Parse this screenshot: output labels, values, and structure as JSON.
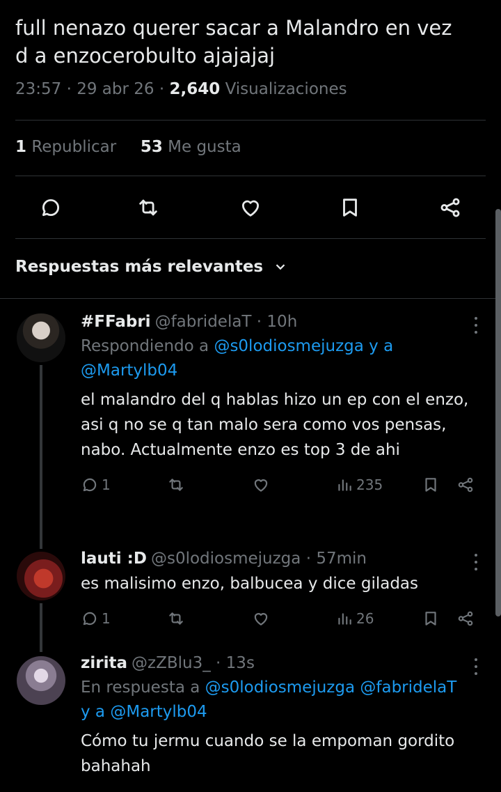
{
  "tweet": {
    "text_line1": "full nenazo querer sacar a Malandro en vez",
    "text_line2": "d a enzocerobulto ajajajaj",
    "time": "23:57",
    "date": "29 abr 26",
    "views_count": "2,640",
    "views_label": "Visualizaciones",
    "reposts_count": "1",
    "reposts_label": "Republicar",
    "likes_count": "53",
    "likes_label": "Me gusta"
  },
  "sort": {
    "label": "Respuestas más relevantes"
  },
  "replies": [
    {
      "name": "#FFabri",
      "handle": "@fabridelaT",
      "time": "10h",
      "replying_prefix": "Respondiendo a",
      "mention1": "@s0lodiosmejuzga",
      "joiner": "y a",
      "mention2": "@Martylb04",
      "text": "el malandro del q hablas hizo un ep con el enzo, asi q no se q tan malo sera como vos pensas, nabo. Actualmente enzo es top 3 de ahi",
      "replies_count": "1",
      "views_count": "235"
    },
    {
      "name": "lauti :D",
      "handle": "@s0lodiosmejuzga",
      "time": "57min",
      "text": "es malisimo enzo, balbucea y dice giladas",
      "replies_count": "1",
      "views_count": "26"
    },
    {
      "name": "zirita",
      "handle": "@zZBlu3_",
      "time": "13s",
      "replying_prefix": "En respuesta a",
      "mention1": "@s0lodiosmejuzga",
      "mention2": "@fabridelaT",
      "joiner": "y a",
      "mention3": "@Martylb04",
      "text": "Cómo tu jermu cuando se la empoman gordito bahahah"
    }
  ],
  "colors": {
    "background": "#000000",
    "text": "#e7e9ea",
    "muted": "#71767b",
    "link": "#1d9bf0",
    "divider": "#2f3336"
  },
  "icons": [
    "reply-icon",
    "repost-icon",
    "like-icon",
    "bookmark-icon",
    "share-icon",
    "chevron-down-icon",
    "views-icon",
    "more-icon"
  ]
}
